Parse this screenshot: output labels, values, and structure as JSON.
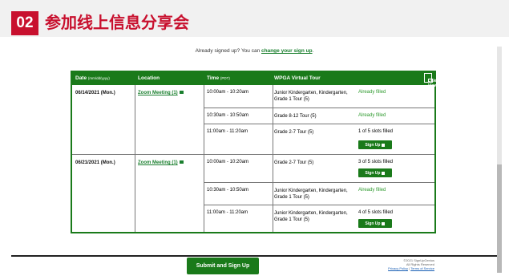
{
  "header": {
    "number": "02",
    "title": "参加线上信息分享会"
  },
  "signed_up": {
    "prefix": "Already signed up? You can ",
    "link": "change your sign up",
    "suffix": "."
  },
  "table": {
    "headers": {
      "date": "Date",
      "date_fmt": "(mm/dd/yyyy)",
      "location": "Location",
      "time": "Time",
      "time_tz": "(PDT)",
      "tour": "WPGA Virtual Tour",
      "calendar": "Calendar View"
    },
    "groups": [
      {
        "date": "06/14/2021 (Mon.)",
        "location": "Zoom Meeting (1)",
        "slots": [
          {
            "time": "10:00am - 10:20am",
            "tour": "Junior Kindergarten, Kindergarten, Grade 1 Tour (5)",
            "status": "Already filled",
            "signup": ""
          },
          {
            "time": "10:30am - 10:50am",
            "tour": "Grade 8-12 Tour (5)",
            "status": "Already filled",
            "signup": ""
          },
          {
            "time": "11:00am - 11:20am",
            "tour": "Grade 2-7 Tour (5)",
            "status": "1 of 5 slots filled",
            "signup": "Sign Up"
          }
        ]
      },
      {
        "date": "06/21/2021 (Mon.)",
        "location": "Zoom Meeting (1)",
        "slots": [
          {
            "time": "10:00am - 10:20am",
            "tour": "Grade 2-7 Tour (5)",
            "status": "3 of 5 slots filled",
            "signup": "Sign Up"
          },
          {
            "time": "10:30am - 10:50am",
            "tour": "Junior Kindergarten, Kindergarten, Grade 1 Tour (5)",
            "status": "Already filled",
            "signup": ""
          },
          {
            "time": "11:00am - 11:20am",
            "tour": "Junior Kindergarten, Kindergarten, Grade 1 Tour (5)",
            "status": "4 of 5 slots filled",
            "signup": "Sign Up"
          }
        ]
      }
    ]
  },
  "footer": {
    "submit": "Submit and Sign Up",
    "copyright": "©2021 SignUpGenius",
    "rights": "All Rights Reserved",
    "privacy": "Privacy Policy",
    "terms": "Terms of Service"
  },
  "colors": {
    "brand_red": "#c8102e",
    "green": "#1a7a1a"
  }
}
